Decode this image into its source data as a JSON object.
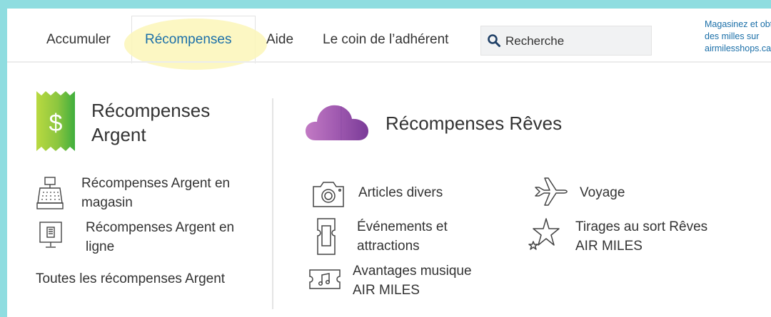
{
  "nav": {
    "items": [
      {
        "label": "Accumuler",
        "active": false
      },
      {
        "label": "Récompenses",
        "active": true
      },
      {
        "label": "Aide",
        "active": false
      },
      {
        "label": "Le coin de l’adhérent",
        "active": false
      }
    ],
    "search_placeholder": "Recherche",
    "promo_lines": [
      "Magasinez et obtenez",
      "des milles sur",
      "airmilesshops.ca"
    ]
  },
  "cash": {
    "title_line1": "Récompenses",
    "title_line2": "Argent",
    "links": [
      {
        "line1": "Récompenses Argent en",
        "line2": "magasin",
        "icon": "cash-register-icon"
      },
      {
        "line1": "Récompenses Argent en",
        "line2": "ligne",
        "icon": "computer-icon"
      }
    ],
    "all_link": "Toutes les récompenses Argent",
    "accent": "#8cc63f"
  },
  "dream": {
    "title": "Récompenses Rêves",
    "links": [
      {
        "line1": "Articles divers",
        "line2": "",
        "icon": "camera-icon"
      },
      {
        "line1": "Événements et",
        "line2": "attractions",
        "icon": "ticket-icon"
      },
      {
        "line1": "Avantages musique",
        "line2": "AIR MILES",
        "icon": "music-ticket-icon"
      },
      {
        "line1": "Voyage",
        "line2": "",
        "icon": "airplane-icon"
      },
      {
        "line1": "Tirages au sort Rêves",
        "line2": "AIR MILES",
        "icon": "stars-icon"
      }
    ],
    "accent": "#a05ab0"
  },
  "colors": {
    "link_blue": "#1b6fa8",
    "background": "#8fdde0",
    "highlight": "#fbf6b9"
  }
}
